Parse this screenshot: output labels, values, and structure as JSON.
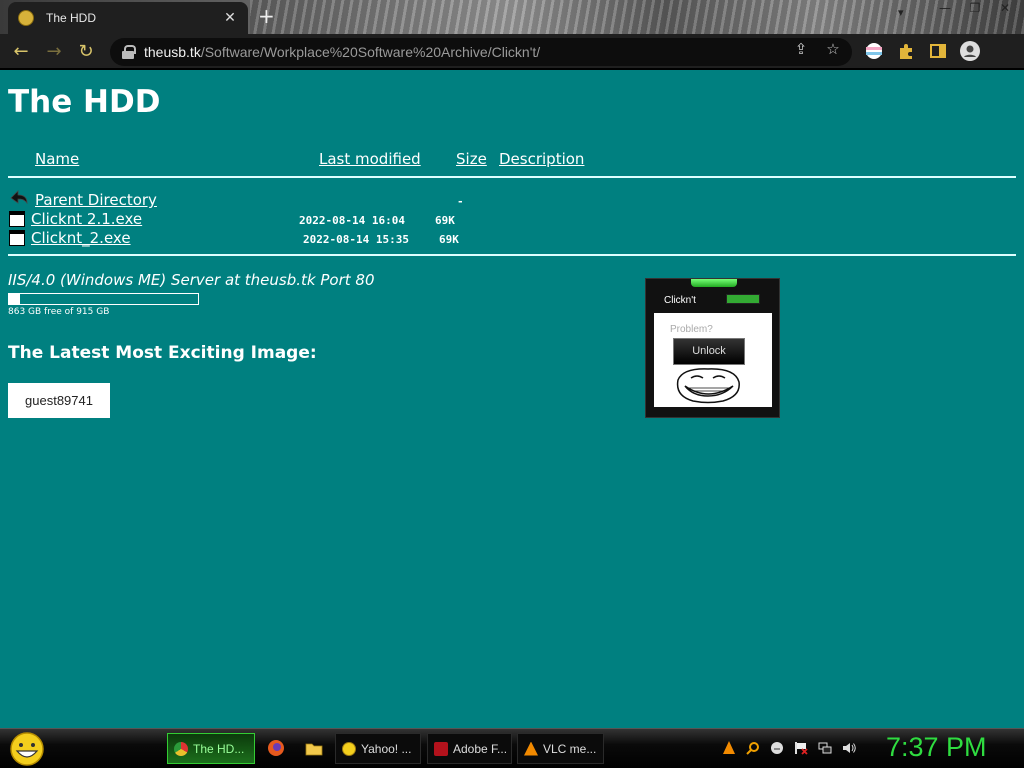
{
  "browser": {
    "tab_title": "The HDD",
    "new_tab": "+",
    "tab_close": "✕",
    "url_host": "theusb.tk",
    "url_path": "/Software/Workplace%20Software%20Archive/Clickn't/",
    "window_controls": {
      "minimize": "—",
      "restore": "❐",
      "close": "✕"
    },
    "icons": [
      "back-icon",
      "forward-icon",
      "reload-icon",
      "lock-icon",
      "share-icon",
      "bookmark-star-icon",
      "extension-icon",
      "puzzle-icon",
      "side-panel-icon",
      "profile-icon"
    ]
  },
  "page": {
    "heading": "The HDD",
    "columns": {
      "name": "Name",
      "last_modified": "Last modified",
      "size": "Size",
      "description": "Description"
    },
    "rows": [
      {
        "name": "Parent Directory",
        "modified": "",
        "size": "-"
      },
      {
        "name": "Clicknt 2.1.exe",
        "modified": "2022-08-14 16:04",
        "size": "69K"
      },
      {
        "name": "Clicknt_2.exe",
        "modified": "2022-08-14 15:35",
        "size": "69K"
      }
    ],
    "server_signature": "IIS/4.0 (Windows ME) Server at theusb.tk Port 80",
    "disk": {
      "text": "863 GB free of 915 GB",
      "used_fraction": 0.057
    },
    "latest_heading": "The Latest Most Exciting Image:",
    "guest_label": "guest89741",
    "clicknt": {
      "title": "Clickn't",
      "problem": "Problem?",
      "button": "Unlock"
    }
  },
  "taskbar": {
    "buttons": [
      {
        "label": "The HD...",
        "active": true
      },
      {
        "label": "Yahoo! ..."
      },
      {
        "label": "Adobe F..."
      },
      {
        "label": "VLC me..."
      }
    ],
    "clock": "7:37 PM"
  }
}
